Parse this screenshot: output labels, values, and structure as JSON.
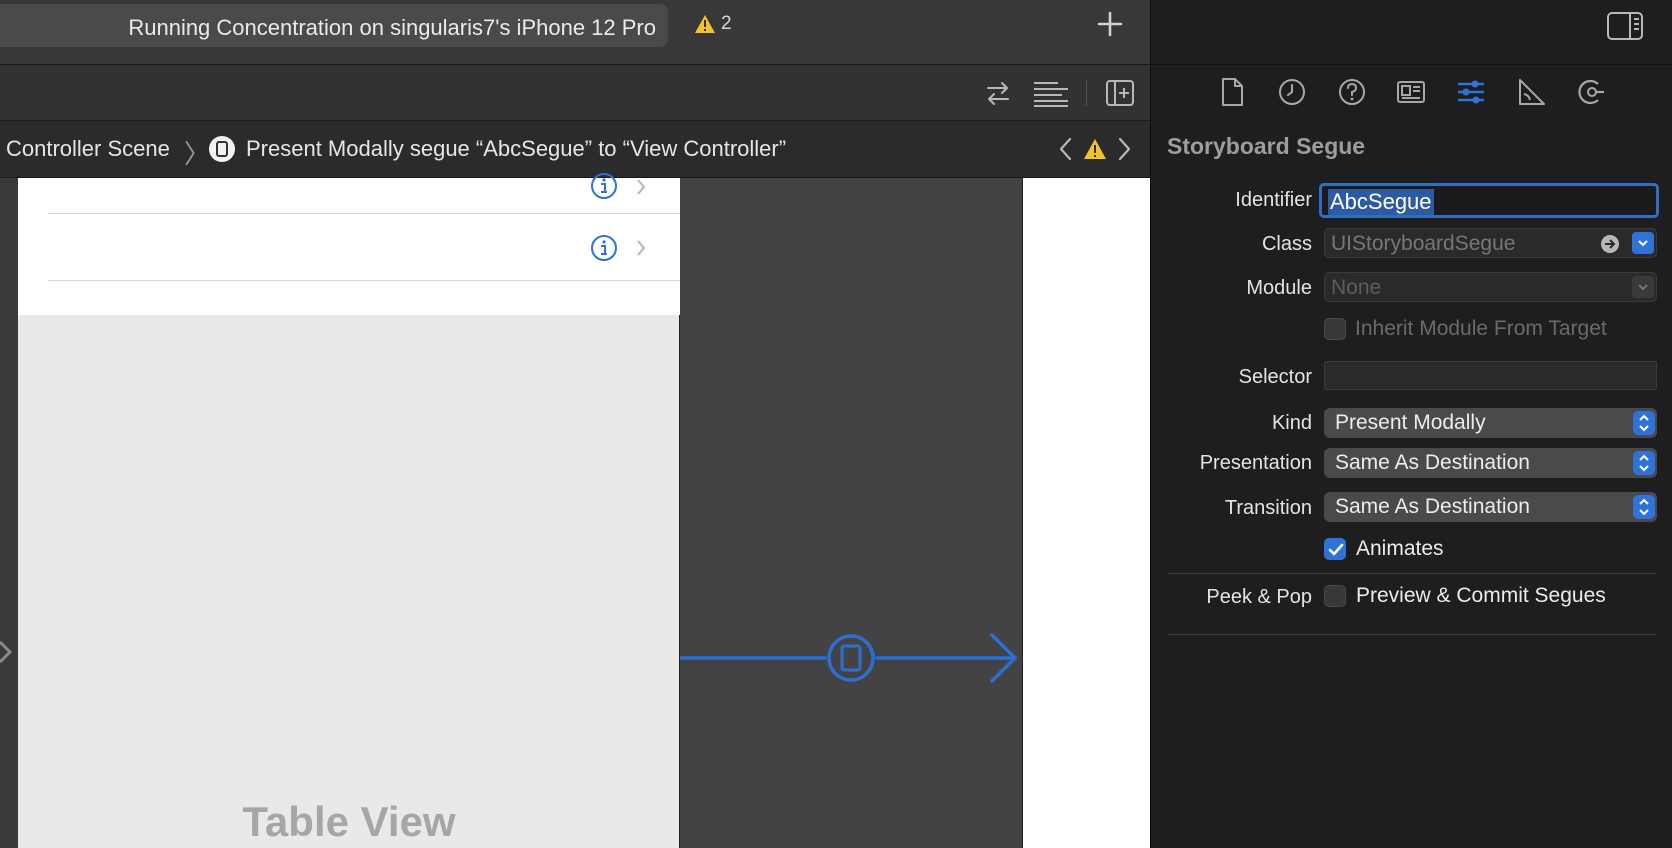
{
  "toolbar": {
    "status": "Running Concentration on singularis7's iPhone 12 Pro",
    "warning_count": "2"
  },
  "jumpbar": {
    "scene": "Controller Scene",
    "segue": "Present Modally segue “AbcSegue” to “View Controller”"
  },
  "canvas": {
    "table_view_label": "Table View"
  },
  "inspector": {
    "section_title": "Storyboard Segue",
    "identifier_label": "Identifier",
    "identifier_value": "AbcSegue",
    "class_label": "Class",
    "class_placeholder": "UIStoryboardSegue",
    "module_label": "Module",
    "module_placeholder": "None",
    "inherit_label": "Inherit Module From Target",
    "inherit_checked": false,
    "selector_label": "Selector",
    "selector_value": "",
    "kind_label": "Kind",
    "kind_value": "Present Modally",
    "presentation_label": "Presentation",
    "presentation_value": "Same As Destination",
    "transition_label": "Transition",
    "transition_value": "Same As Destination",
    "animates_label": "Animates",
    "animates_checked": true,
    "peek_label": "Peek & Pop",
    "peek_option_label": "Preview & Commit Segues",
    "peek_checked": false,
    "tabs": [
      "file-inspector-icon",
      "history-inspector-icon",
      "quick-help-icon",
      "identity-inspector-icon",
      "attributes-inspector-icon",
      "size-inspector-icon",
      "connections-inspector-icon"
    ]
  },
  "colors": {
    "accent": "#2f73d8",
    "warning": "#f5c12e",
    "segue": "#2c6fd1"
  }
}
